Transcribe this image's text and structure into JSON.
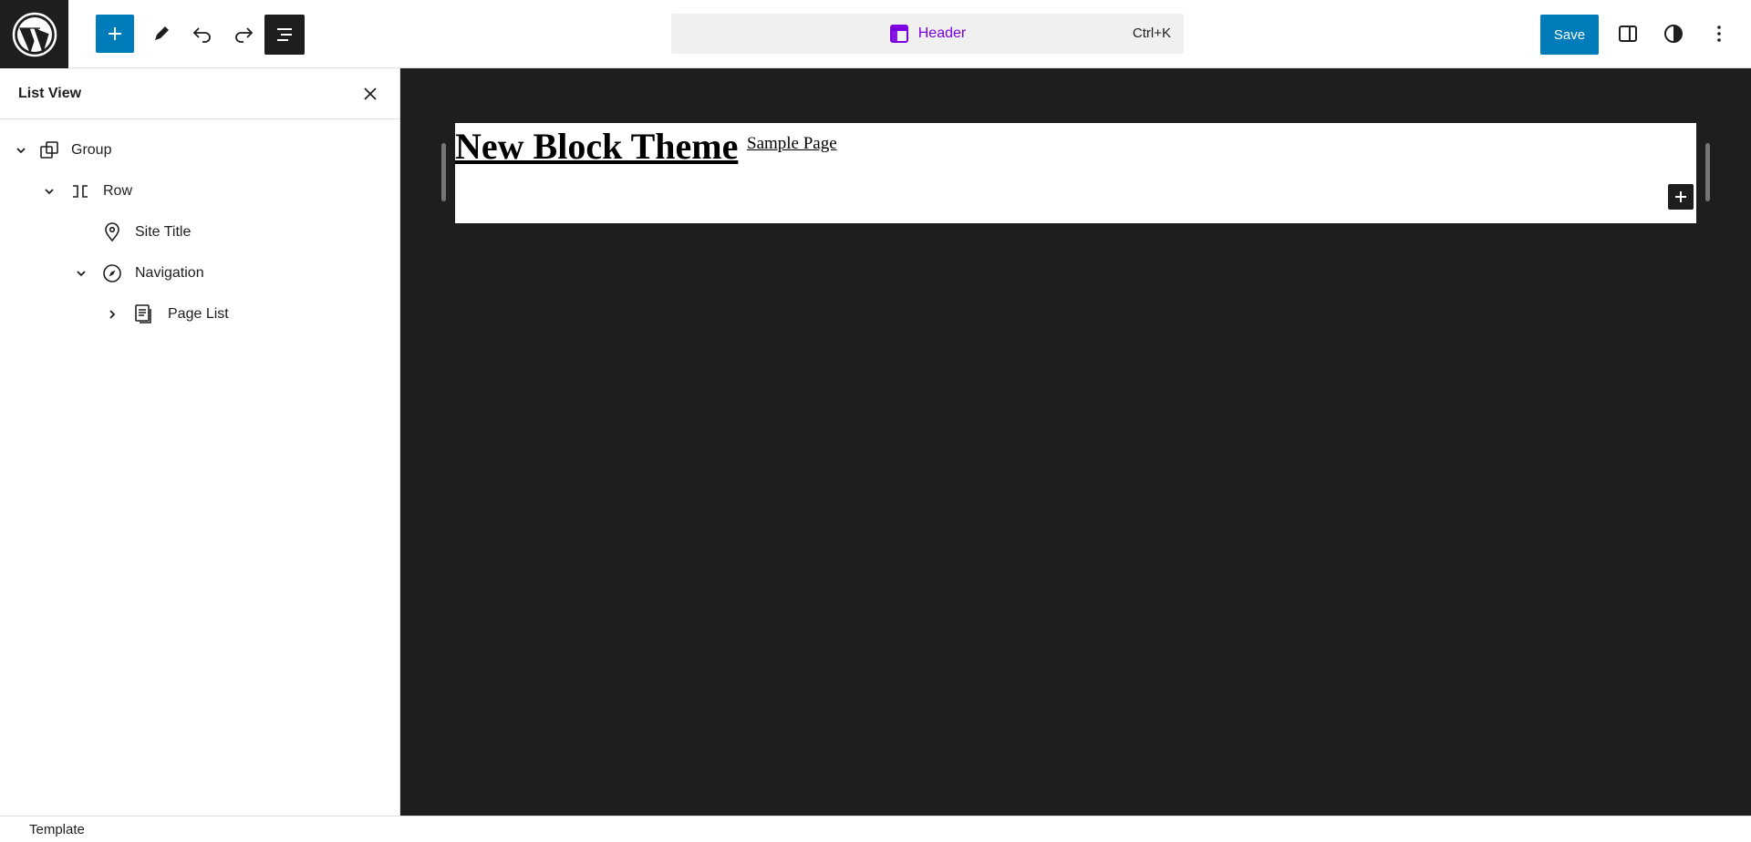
{
  "toolbar": {
    "logo_icon": "wordpress-logo",
    "add_icon": "plus-icon",
    "edit_icon": "pencil-icon",
    "undo_icon": "undo-icon",
    "redo_icon": "redo-icon",
    "list_view_icon": "list-view-icon"
  },
  "command_bar": {
    "title": "Header",
    "icon": "template-part-icon",
    "shortcut": "Ctrl+K"
  },
  "actions": {
    "save_label": "Save",
    "settings_icon": "sidebar-icon",
    "styles_icon": "half-circle-contrast-icon",
    "options_icon": "vertical-dots-icon"
  },
  "list_view": {
    "title": "List View",
    "close_icon": "close-icon",
    "items": [
      {
        "label": "Group",
        "icon": "group-icon",
        "toggle": "expanded"
      },
      {
        "label": "Row",
        "icon": "row-icon",
        "toggle": "expanded"
      },
      {
        "label": "Site Title",
        "icon": "map-pin-icon",
        "toggle": "none"
      },
      {
        "label": "Navigation",
        "icon": "compass-icon",
        "toggle": "expanded"
      },
      {
        "label": "Page List",
        "icon": "page-list-icon",
        "toggle": "collapsed"
      }
    ]
  },
  "canvas": {
    "site_title": "New Block Theme",
    "nav_link": "Sample Page"
  },
  "footer": {
    "breadcrumb": "Template"
  },
  "colors": {
    "accent": "#007cba",
    "command_text": "#7a00df",
    "dark": "#1e1e1e"
  }
}
